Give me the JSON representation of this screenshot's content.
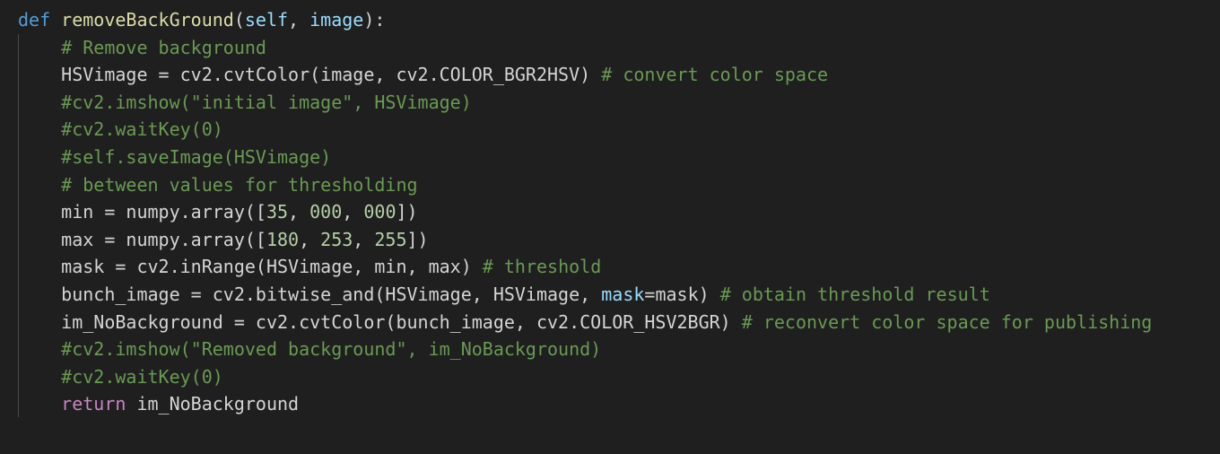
{
  "colors": {
    "background": "#1f1f1f",
    "keyword": "#569cd6",
    "control_keyword": "#c586c0",
    "function": "#dcdcaa",
    "parameter": "#9cdcfe",
    "number": "#b5cea8",
    "comment": "#6a9955",
    "default": "#d4d4d4"
  },
  "code": {
    "lines": [
      {
        "indent": 0,
        "tokens": [
          {
            "t": "kw",
            "v": "def"
          },
          {
            "t": "plain",
            "v": " "
          },
          {
            "t": "fn",
            "v": "removeBackGround"
          },
          {
            "t": "plain",
            "v": "("
          },
          {
            "t": "param",
            "v": "self"
          },
          {
            "t": "plain",
            "v": ", "
          },
          {
            "t": "param",
            "v": "image"
          },
          {
            "t": "plain",
            "v": "):"
          }
        ]
      },
      {
        "indent": 1,
        "tokens": [
          {
            "t": "comment",
            "v": "# Remove background"
          }
        ]
      },
      {
        "indent": 1,
        "tokens": [
          {
            "t": "plain",
            "v": "HSVimage = cv2.cvtColor(image, cv2.COLOR_BGR2HSV) "
          },
          {
            "t": "comment",
            "v": "# convert color space"
          }
        ]
      },
      {
        "indent": 1,
        "tokens": [
          {
            "t": "comment",
            "v": "#cv2.imshow(\"initial image\", HSVimage)"
          }
        ]
      },
      {
        "indent": 1,
        "tokens": [
          {
            "t": "comment",
            "v": "#cv2.waitKey(0)"
          }
        ]
      },
      {
        "indent": 1,
        "tokens": [
          {
            "t": "comment",
            "v": "#self.saveImage(HSVimage)"
          }
        ]
      },
      {
        "indent": 1,
        "tokens": [
          {
            "t": "comment",
            "v": "# between values for thresholding"
          }
        ]
      },
      {
        "indent": 1,
        "tokens": [
          {
            "t": "plain",
            "v": "min = numpy.array(["
          },
          {
            "t": "num",
            "v": "35"
          },
          {
            "t": "plain",
            "v": ", "
          },
          {
            "t": "num",
            "v": "000"
          },
          {
            "t": "plain",
            "v": ", "
          },
          {
            "t": "num",
            "v": "000"
          },
          {
            "t": "plain",
            "v": "])"
          }
        ]
      },
      {
        "indent": 1,
        "tokens": [
          {
            "t": "plain",
            "v": "max = numpy.array(["
          },
          {
            "t": "num",
            "v": "180"
          },
          {
            "t": "plain",
            "v": ", "
          },
          {
            "t": "num",
            "v": "253"
          },
          {
            "t": "plain",
            "v": ", "
          },
          {
            "t": "num",
            "v": "255"
          },
          {
            "t": "plain",
            "v": "])"
          }
        ]
      },
      {
        "indent": 1,
        "tokens": [
          {
            "t": "plain",
            "v": "mask = cv2.inRange(HSVimage, min, max) "
          },
          {
            "t": "comment",
            "v": "# threshold"
          }
        ]
      },
      {
        "indent": 1,
        "tokens": [
          {
            "t": "plain",
            "v": "bunch_image = cv2.bitwise_and(HSVimage, HSVimage, "
          },
          {
            "t": "param",
            "v": "mask"
          },
          {
            "t": "plain",
            "v": "=mask) "
          },
          {
            "t": "comment",
            "v": "# obtain threshold result"
          }
        ]
      },
      {
        "indent": 1,
        "tokens": [
          {
            "t": "plain",
            "v": "im_NoBackground = cv2.cvtColor(bunch_image, cv2.COLOR_HSV2BGR) "
          },
          {
            "t": "comment",
            "v": "# reconvert color space for publishing"
          }
        ]
      },
      {
        "indent": 1,
        "tokens": [
          {
            "t": "comment",
            "v": "#cv2.imshow(\"Removed background\", im_NoBackground)"
          }
        ]
      },
      {
        "indent": 1,
        "tokens": [
          {
            "t": "comment",
            "v": "#cv2.waitKey(0)"
          }
        ]
      },
      {
        "indent": 1,
        "tokens": [
          {
            "t": "kw-ctrl",
            "v": "return"
          },
          {
            "t": "plain",
            "v": " im_NoBackground"
          }
        ]
      }
    ]
  }
}
